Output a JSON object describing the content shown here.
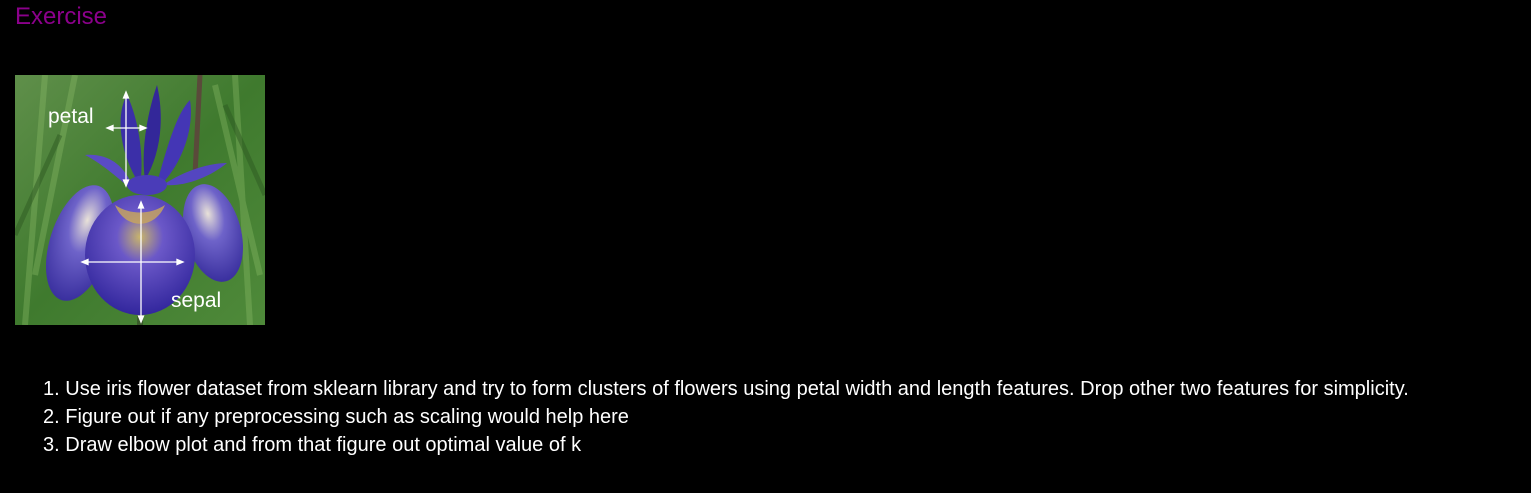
{
  "cell": {
    "heading": "Exercise"
  },
  "figure": {
    "petal_label": "petal",
    "sepal_label": "sepal"
  },
  "tasks": [
    {
      "number": "1.",
      "text": "Use iris flower dataset from sklearn library and try to form clusters of flowers using petal width and length features. Drop other two features for simplicity."
    },
    {
      "number": "2.",
      "text": "Figure out if any preprocessing such as scaling would help here"
    },
    {
      "number": "3.",
      "text": "Draw elbow plot and from that figure out optimal value of k"
    }
  ],
  "colors": {
    "background": "#000000",
    "heading": "#8b008b",
    "text": "#ffffff",
    "petal": "#3b2fa8",
    "foliage": "#3f7a2e"
  }
}
